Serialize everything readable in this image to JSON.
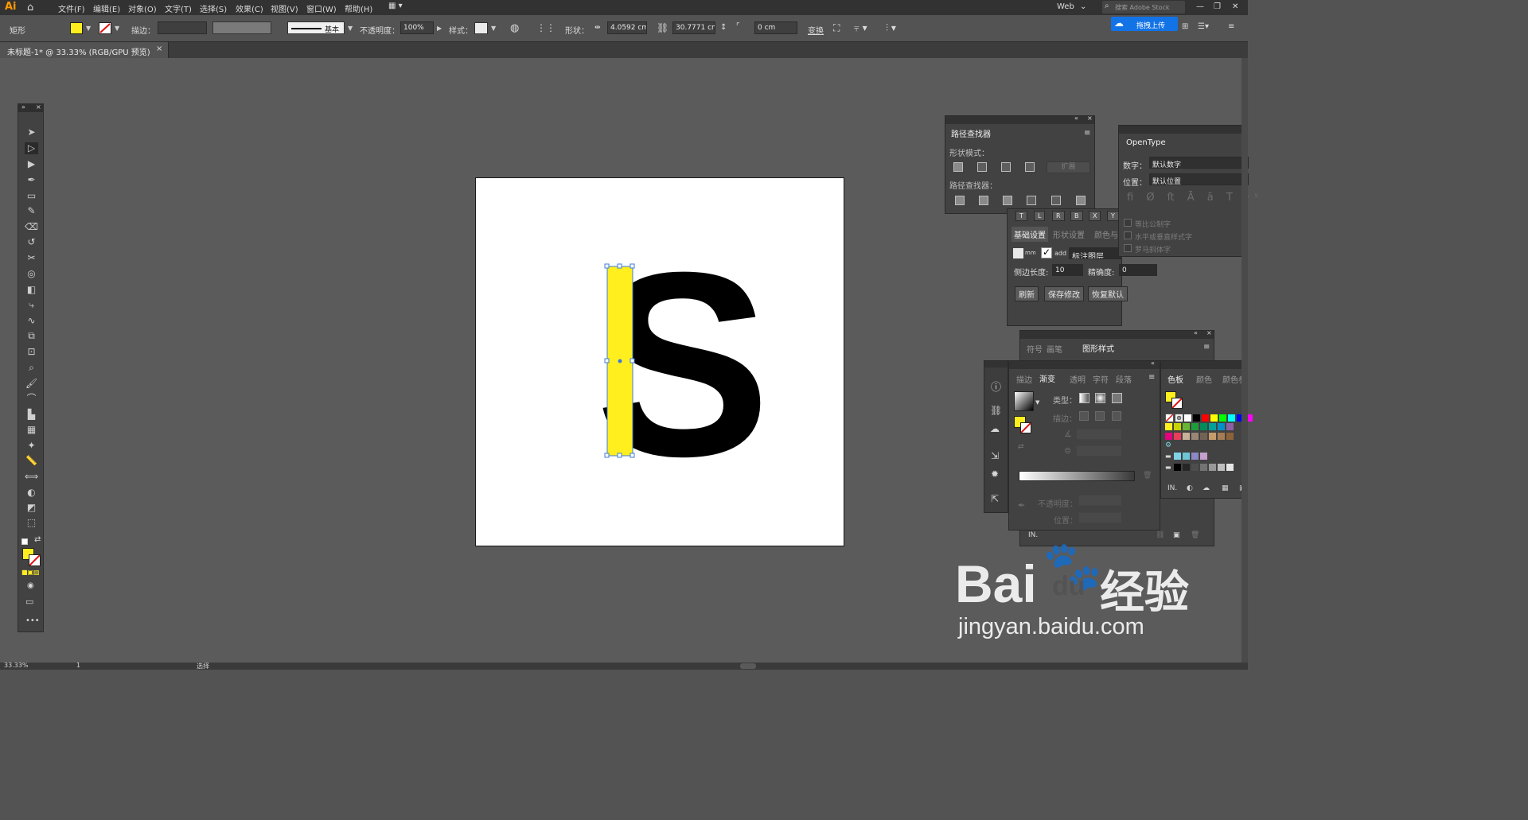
{
  "app": {
    "logo": "Ai",
    "workspace": "Web",
    "search_placeholder": "搜索 Adobe Stock",
    "upload_label": "拖拽上传"
  },
  "menu": [
    "文件(F)",
    "编辑(E)",
    "对象(O)",
    "文字(T)",
    "选择(S)",
    "效果(C)",
    "视图(V)",
    "窗口(W)",
    "帮助(H)"
  ],
  "control": {
    "object_type": "矩形",
    "stroke_label": "描边：",
    "stroke_profile": "基本",
    "opacity_label": "不透明度：",
    "opacity": "100%",
    "style_label": "样式：",
    "shape_label": "形状：",
    "width": "4.0592 cm",
    "height": "30.7771 cm",
    "corner": "0 cm",
    "transform_label": "变换",
    "fill_color": "#ffef1f"
  },
  "document": {
    "tab": "未标题-1* @ 33.33% (RGB/GPU 预览)",
    "close": "×"
  },
  "canvas": {
    "letter": "S",
    "rect_color": "#ffef1f",
    "letter_color": "#000000"
  },
  "pathfinder": {
    "title": "路径查找器",
    "shape_modes": "形状模式：",
    "expand": "扩展",
    "pathfinders": "路径查找器："
  },
  "opentype": {
    "title": "OpenType",
    "number_label": "数字：",
    "number_value": "默认数字",
    "position_label": "位置：",
    "position_value": "默认位置",
    "opt1": "等比公制字",
    "opt2": "水平或垂直样式字",
    "opt3": "罗马斜体字"
  },
  "plugin": {
    "tab1": "基础设置",
    "tab2": "形状设置",
    "tab3": "颜色与",
    "unit": "mm",
    "add": "add",
    "layer": "标注图层",
    "side_label": "侧边长度:",
    "side_value": "10",
    "precision_label": "精确度:",
    "precision_value": "0",
    "refresh": "刷新",
    "save": "保存修改",
    "restore": "恢复默认",
    "letters": [
      "T",
      "L",
      "R",
      "B",
      "X",
      "Y"
    ]
  },
  "styles": {
    "tab1": "符号",
    "tab2": "画笔",
    "tab3": "图形样式"
  },
  "gradient": {
    "tab_stroke": "描边",
    "tab_gradient": "渐变",
    "tab_transparency": "透明",
    "tab_char": "字符",
    "tab_para": "段落",
    "type_label": "类型：",
    "stroke_label": "描边：",
    "opacity_label": "不透明度：",
    "position_label": "位置："
  },
  "swatches": {
    "tab1": "色板",
    "tab2": "颜色",
    "tab3": "颜色参",
    "row1": [
      "#ffffff",
      "#000000",
      "#ff0000",
      "#ffff00",
      "#00ff00",
      "#00ffff",
      "#0000ff",
      "#ff00ff"
    ],
    "row2": [
      "#ffef1f",
      "#c8d400",
      "#6ab534",
      "#1e9d3a",
      "#008d5b",
      "#00a19a",
      "#0091c8",
      "#8e5ea6"
    ],
    "row3": [
      "#e5007e",
      "#e83d5b",
      "#c7b299",
      "#998675",
      "#736357",
      "#c69c6d",
      "#a67c52",
      "#8c6239"
    ],
    "row4": [
      "#7fd2e8",
      "#6ec6d4",
      "#8e87c4",
      "#c4a0cf"
    ],
    "row5": [
      "#000000",
      "#262626",
      "#4d4d4d",
      "#737373",
      "#999999",
      "#bfbfbf",
      "#e6e6e6"
    ]
  },
  "status": {
    "zoom": "33.33%",
    "page": "1",
    "tool": "选择"
  },
  "watermark": {
    "brand": "Bai",
    "brand2": "du",
    "cn": "经验",
    "url": "jingyan.baidu.com"
  }
}
